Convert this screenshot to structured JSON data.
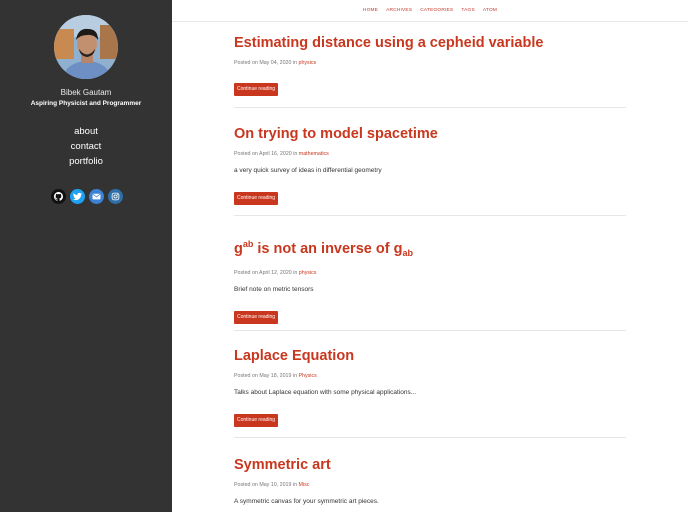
{
  "author": {
    "name": "Bibek Gautam",
    "tagline": "Aspiring Physicist and Programmer"
  },
  "sidebar_links": [
    "about",
    "contact",
    "portfolio"
  ],
  "social_icons": [
    "github-icon",
    "twitter-icon",
    "email-icon",
    "instagram-icon"
  ],
  "nav": [
    "HOME",
    "ARCHIVES",
    "CATEGORIES",
    "TAGS",
    "ATOM"
  ],
  "colors": {
    "accent": "#c8371e",
    "sidebar": "#333333"
  },
  "posts": [
    {
      "title": "Estimating distance using a cepheid variable",
      "date": "Posted on May 04, 2020 in ",
      "category": "physics",
      "excerpt": "",
      "button": "Continue reading"
    },
    {
      "title": "On trying to model spacetime",
      "date": "Posted on April 16, 2020 in ",
      "category": "mathematics",
      "excerpt": "a very quick survey of ideas in differential geometry",
      "button": "Continue reading"
    },
    {
      "title_base": "g",
      "title_sup": "ab",
      "title_mid": " is not an inverse of g",
      "title_sub": "ab",
      "date": "Posted on April 12, 2020 in ",
      "category": "physics",
      "excerpt": "Brief note on metric tensors",
      "button": "Continue reading"
    },
    {
      "title": "Laplace Equation",
      "date": "Posted on May 18, 2019 in ",
      "category": "Physics",
      "excerpt": "Talks about Laplace equation with some physical applications...",
      "button": "Continue reading"
    },
    {
      "title": "Symmetric art",
      "date": "Posted on May 10, 2019 in ",
      "category": "Misc",
      "excerpt": "A symmetric canvas for your symmetric art pieces.",
      "button": ""
    }
  ]
}
